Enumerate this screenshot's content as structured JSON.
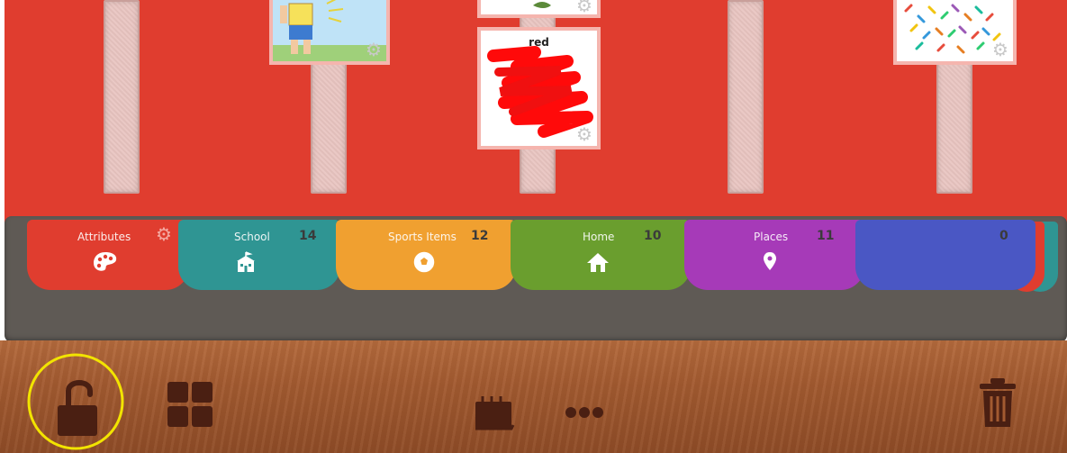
{
  "cards": {
    "red_label": "red"
  },
  "tabs": [
    {
      "label": "Attributes",
      "count": "",
      "color": "#e03d2f",
      "icon": "palette-icon"
    },
    {
      "label": "School",
      "count": "14",
      "color": "#2f9593",
      "icon": "school-icon"
    },
    {
      "label": "Sports Items",
      "count": "12",
      "color": "#f0a030",
      "icon": "soccer-ball-icon"
    },
    {
      "label": "Home",
      "count": "10",
      "color": "#6a9e2e",
      "icon": "home-icon"
    },
    {
      "label": "Places",
      "count": "11",
      "color": "#a63ab8",
      "icon": "map-pin-icon"
    },
    {
      "label": "",
      "count": "0",
      "color": "#4a57c4",
      "icon": ""
    }
  ],
  "toolbar": {
    "lock": "unlock-icon",
    "grid": "grid-icon",
    "calendar": "calendar-icon",
    "more": "more-icon",
    "trash": "trash-icon",
    "highlight_color": "#f2e400"
  }
}
